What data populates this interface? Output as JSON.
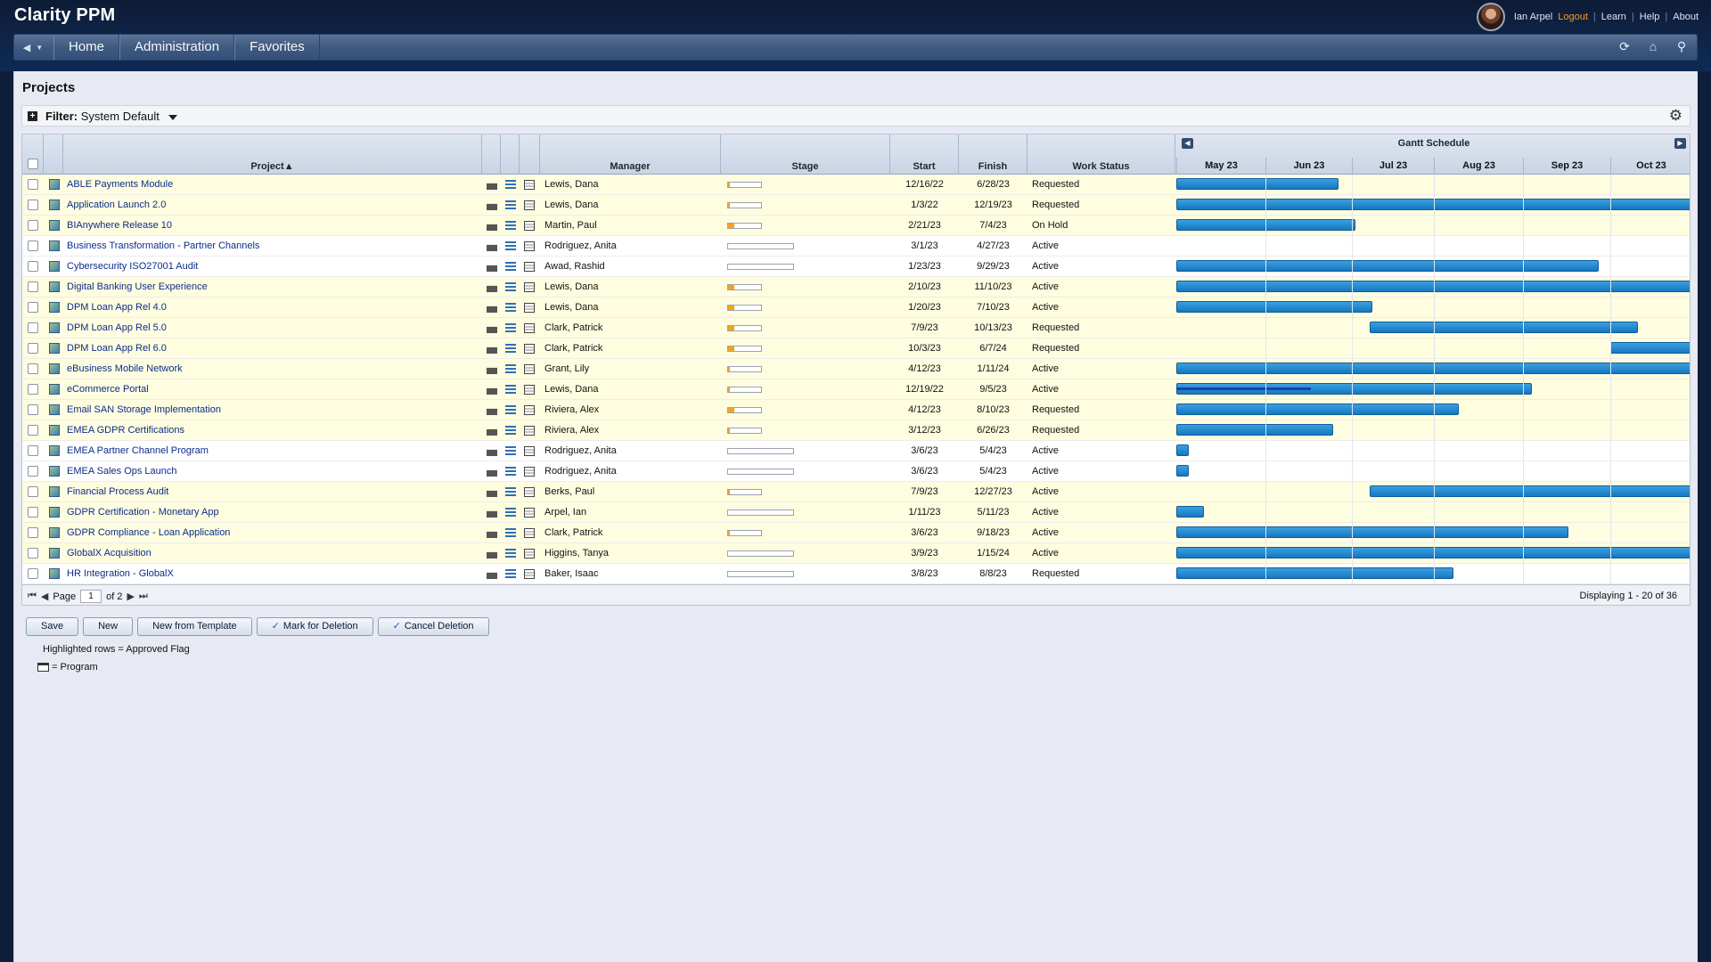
{
  "app": {
    "title": "Clarity PPM"
  },
  "user": {
    "name": "Ian Arpel",
    "logout": "Logout",
    "learn": "Learn",
    "help": "Help",
    "about": "About"
  },
  "nav": {
    "tabs": [
      "Home",
      "Administration",
      "Favorites"
    ]
  },
  "page": {
    "title": "Projects"
  },
  "filter": {
    "label": "Filter:",
    "value": "System Default"
  },
  "columns": {
    "project": "Project",
    "manager": "Manager",
    "stage": "Stage",
    "start": "Start",
    "finish": "Finish",
    "work_status": "Work Status"
  },
  "gantt": {
    "title": "Gantt Schedule",
    "months": [
      "May 23",
      "Jun 23",
      "Jul 23",
      "Aug 23",
      "Sep 23",
      "Oct 23"
    ]
  },
  "rows": [
    {
      "name": "ABLE Payments Module",
      "manager": "Lewis, Dana",
      "start": "12/16/22",
      "finish": "6/28/23",
      "status": "Requested",
      "highlight": true,
      "stage_progress": 0.05
    },
    {
      "name": "Application Launch 2.0",
      "manager": "Lewis, Dana",
      "start": "1/3/22",
      "finish": "12/19/23",
      "status": "Requested",
      "highlight": true,
      "stage_progress": 0.05
    },
    {
      "name": "BIAnywhere Release 10",
      "manager": "Martin, Paul",
      "start": "2/21/23",
      "finish": "7/4/23",
      "status": "On Hold",
      "highlight": true,
      "stage_progress": 0.2
    },
    {
      "name": "Business Transformation - Partner Channels",
      "manager": "Rodriguez, Anita",
      "start": "3/1/23",
      "finish": "4/27/23",
      "status": "Active",
      "highlight": false,
      "stage_progress": 0
    },
    {
      "name": "Cybersecurity ISO27001 Audit",
      "manager": "Awad, Rashid",
      "start": "1/23/23",
      "finish": "9/29/23",
      "status": "Active",
      "highlight": false,
      "stage_progress": 0
    },
    {
      "name": "Digital Banking User Experience",
      "manager": "Lewis, Dana",
      "start": "2/10/23",
      "finish": "11/10/23",
      "status": "Active",
      "highlight": true,
      "stage_progress": 0.2
    },
    {
      "name": "DPM Loan App Rel 4.0",
      "manager": "Lewis, Dana",
      "start": "1/20/23",
      "finish": "7/10/23",
      "status": "Active",
      "highlight": true,
      "stage_progress": 0.2
    },
    {
      "name": "DPM Loan App Rel 5.0",
      "manager": "Clark, Patrick",
      "start": "7/9/23",
      "finish": "10/13/23",
      "status": "Requested",
      "highlight": true,
      "stage_progress": 0.2
    },
    {
      "name": "DPM Loan App Rel 6.0",
      "manager": "Clark, Patrick",
      "start": "10/3/23",
      "finish": "6/7/24",
      "status": "Requested",
      "highlight": true,
      "stage_progress": 0.2
    },
    {
      "name": "eBusiness Mobile Network",
      "manager": "Grant, Lily",
      "start": "4/12/23",
      "finish": "1/11/24",
      "status": "Active",
      "highlight": true,
      "stage_progress": 0.05
    },
    {
      "name": "eCommerce Portal",
      "manager": "Lewis, Dana",
      "start": "12/19/22",
      "finish": "9/5/23",
      "status": "Active",
      "highlight": true,
      "stage_progress": 0.05
    },
    {
      "name": "Email SAN Storage Implementation",
      "manager": "Riviera, Alex",
      "start": "4/12/23",
      "finish": "8/10/23",
      "status": "Requested",
      "highlight": true,
      "stage_progress": 0.2
    },
    {
      "name": "EMEA GDPR Certifications",
      "manager": "Riviera, Alex",
      "start": "3/12/23",
      "finish": "6/26/23",
      "status": "Requested",
      "highlight": true,
      "stage_progress": 0.05
    },
    {
      "name": "EMEA Partner Channel Program",
      "manager": "Rodriguez, Anita",
      "start": "3/6/23",
      "finish": "5/4/23",
      "status": "Active",
      "highlight": false,
      "stage_progress": 0
    },
    {
      "name": "EMEA Sales Ops Launch",
      "manager": "Rodriguez, Anita",
      "start": "3/6/23",
      "finish": "5/4/23",
      "status": "Active",
      "highlight": false,
      "stage_progress": 0
    },
    {
      "name": "Financial Process Audit",
      "manager": "Berks, Paul",
      "start": "7/9/23",
      "finish": "12/27/23",
      "status": "Active",
      "highlight": true,
      "stage_progress": 0.05
    },
    {
      "name": "GDPR Certification - Monetary App",
      "manager": "Arpel, Ian",
      "start": "1/11/23",
      "finish": "5/11/23",
      "status": "Active",
      "highlight": true,
      "stage_progress": 0
    },
    {
      "name": "GDPR Compliance - Loan Application",
      "manager": "Clark, Patrick",
      "start": "3/6/23",
      "finish": "9/18/23",
      "status": "Active",
      "highlight": true,
      "stage_progress": 0.05
    },
    {
      "name": "GlobalX Acquisition",
      "manager": "Higgins, Tanya",
      "start": "3/9/23",
      "finish": "1/15/24",
      "status": "Active",
      "highlight": true,
      "stage_progress": 0
    },
    {
      "name": "HR Integration - GlobalX",
      "manager": "Baker, Isaac",
      "start": "3/8/23",
      "finish": "8/8/23",
      "status": "Requested",
      "highlight": false,
      "stage_progress": 0
    }
  ],
  "pager": {
    "label": "Page",
    "page": "1",
    "of": "of 2",
    "displaying": "Displaying 1 - 20 of 36"
  },
  "buttons": {
    "save": "Save",
    "new": "New",
    "new_from_template": "New from Template",
    "mark_for_deletion": "Mark for Deletion",
    "cancel_deletion": "Cancel Deletion"
  },
  "legend": {
    "highlighted": "Highlighted rows = Approved Flag",
    "program": "= Program"
  },
  "colors": {
    "header_bg": "#0f2547",
    "gantt_bar": "#1b86cf",
    "highlight_row": "#fefde0",
    "link": "#0c2d8a",
    "logout": "#ff9a1a"
  }
}
